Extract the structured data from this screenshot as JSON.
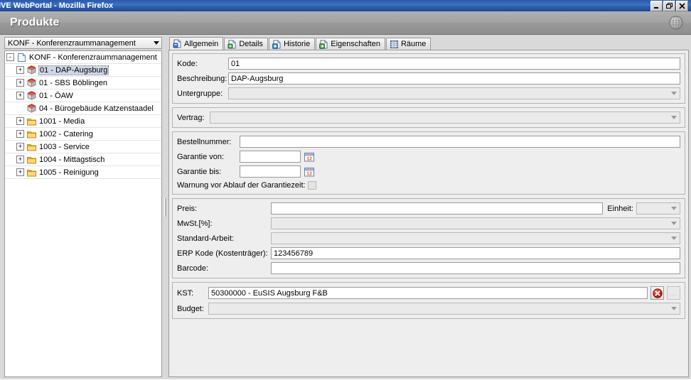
{
  "window": {
    "title": "IVE WebPortal - Mozilla Firefox",
    "buttons": {
      "minimize": "minimize-button",
      "restore": "restore-button",
      "close": "close-button"
    }
  },
  "header": {
    "title": "Produkte",
    "icon": "globe-icon"
  },
  "sidebar": {
    "combo": {
      "value": "KONF - Konferenzraummanagement",
      "arrow": "chevron-down-icon"
    },
    "tree": [
      {
        "label": "KONF - Konferenzraummanagement",
        "icon": "document-icon",
        "expander": "-",
        "depth": 0,
        "selected": false
      },
      {
        "label": "01 - DAP-Augsburg",
        "icon": "box-icon",
        "expander": "+",
        "depth": 1,
        "selected": true
      },
      {
        "label": "01 - SBS Böblingen",
        "icon": "box-icon",
        "expander": "+",
        "depth": 1,
        "selected": false
      },
      {
        "label": "01 - ÖAW",
        "icon": "box-icon",
        "expander": "+",
        "depth": 1,
        "selected": false
      },
      {
        "label": "04 - Bürogebäude Katzenstaadel",
        "icon": "box-icon",
        "expander": "",
        "depth": 1,
        "selected": false
      },
      {
        "label": "1001 - Media",
        "icon": "folder-icon",
        "expander": "+",
        "depth": 1,
        "selected": false
      },
      {
        "label": "1002 - Catering",
        "icon": "folder-icon",
        "expander": "+",
        "depth": 1,
        "selected": false
      },
      {
        "label": "1003 - Service",
        "icon": "folder-icon",
        "expander": "+",
        "depth": 1,
        "selected": false
      },
      {
        "label": "1004 - Mittagstisch",
        "icon": "folder-icon",
        "expander": "+",
        "depth": 1,
        "selected": false
      },
      {
        "label": "1005 - Reinigung",
        "icon": "folder-icon",
        "expander": "+",
        "depth": 1,
        "selected": false
      }
    ]
  },
  "tabs": [
    {
      "label": "Allgemein",
      "icon": "page-blue-icon",
      "active": true
    },
    {
      "label": "Details",
      "icon": "page-green-icon",
      "active": false
    },
    {
      "label": "Historie",
      "icon": "page-plus-icon",
      "active": false
    },
    {
      "label": "Eigenschaften",
      "icon": "page-arrow-icon",
      "active": false
    },
    {
      "label": "Räume",
      "icon": "database-icon",
      "active": false
    }
  ],
  "form": {
    "group1": {
      "kode": {
        "label": "Kode:",
        "value": "01",
        "enabled": true
      },
      "beschreibung": {
        "label": "Beschreibung:",
        "value": "DAP-Augsburg",
        "enabled": true
      },
      "untergruppe": {
        "label": "Untergruppe:",
        "value": "",
        "enabled": false
      }
    },
    "group2": {
      "vertrag": {
        "label": "Vertrag:",
        "value": "",
        "enabled": false
      }
    },
    "group3": {
      "bestellnummer": {
        "label": "Bestellnummer:",
        "value": "",
        "enabled": true
      },
      "garantie_von": {
        "label": "Garantie von:",
        "value": "",
        "enabled": true,
        "icon": "calendar-icon"
      },
      "garantie_bis": {
        "label": "Garantie bis:",
        "value": "",
        "enabled": true,
        "icon": "calendar-icon"
      },
      "warnung": {
        "label": "Warnung vor Ablauf der Garantiezeit:",
        "checked": false
      }
    },
    "group4": {
      "preis": {
        "label": "Preis:",
        "value": "",
        "enabled": true
      },
      "einheit": {
        "label": "Einheit:",
        "value": "",
        "enabled": false
      },
      "mwst": {
        "label": "MwSt.[%]:",
        "value": "",
        "enabled": false
      },
      "standardarbeit": {
        "label": "Standard-Arbeit:",
        "value": "",
        "enabled": false
      },
      "erpkode": {
        "label": "ERP Kode (Kostenträger):",
        "value": "123456789",
        "enabled": true
      },
      "barcode": {
        "label": "Barcode:",
        "value": "",
        "enabled": true
      }
    },
    "group5": {
      "kst": {
        "label": "KST:",
        "value": "50300000 - EuSIS Augsburg F&B",
        "enabled": true
      },
      "budget": {
        "label": "Budget:",
        "value": "",
        "enabled": false
      },
      "clear_button": {
        "icon": "delete-circle-icon",
        "title": ""
      },
      "browse_button": {
        "label": "...",
        "enabled": false
      }
    }
  },
  "colors": {
    "title_bar": "#2f62b2",
    "header_bar": "#9a9a9a",
    "panel_bg": "#eeeeee",
    "selection": "#cfd8e8",
    "delete_red": "#d32020",
    "folder_yellow": "#f5c04a",
    "box_red": "#e8402a"
  }
}
